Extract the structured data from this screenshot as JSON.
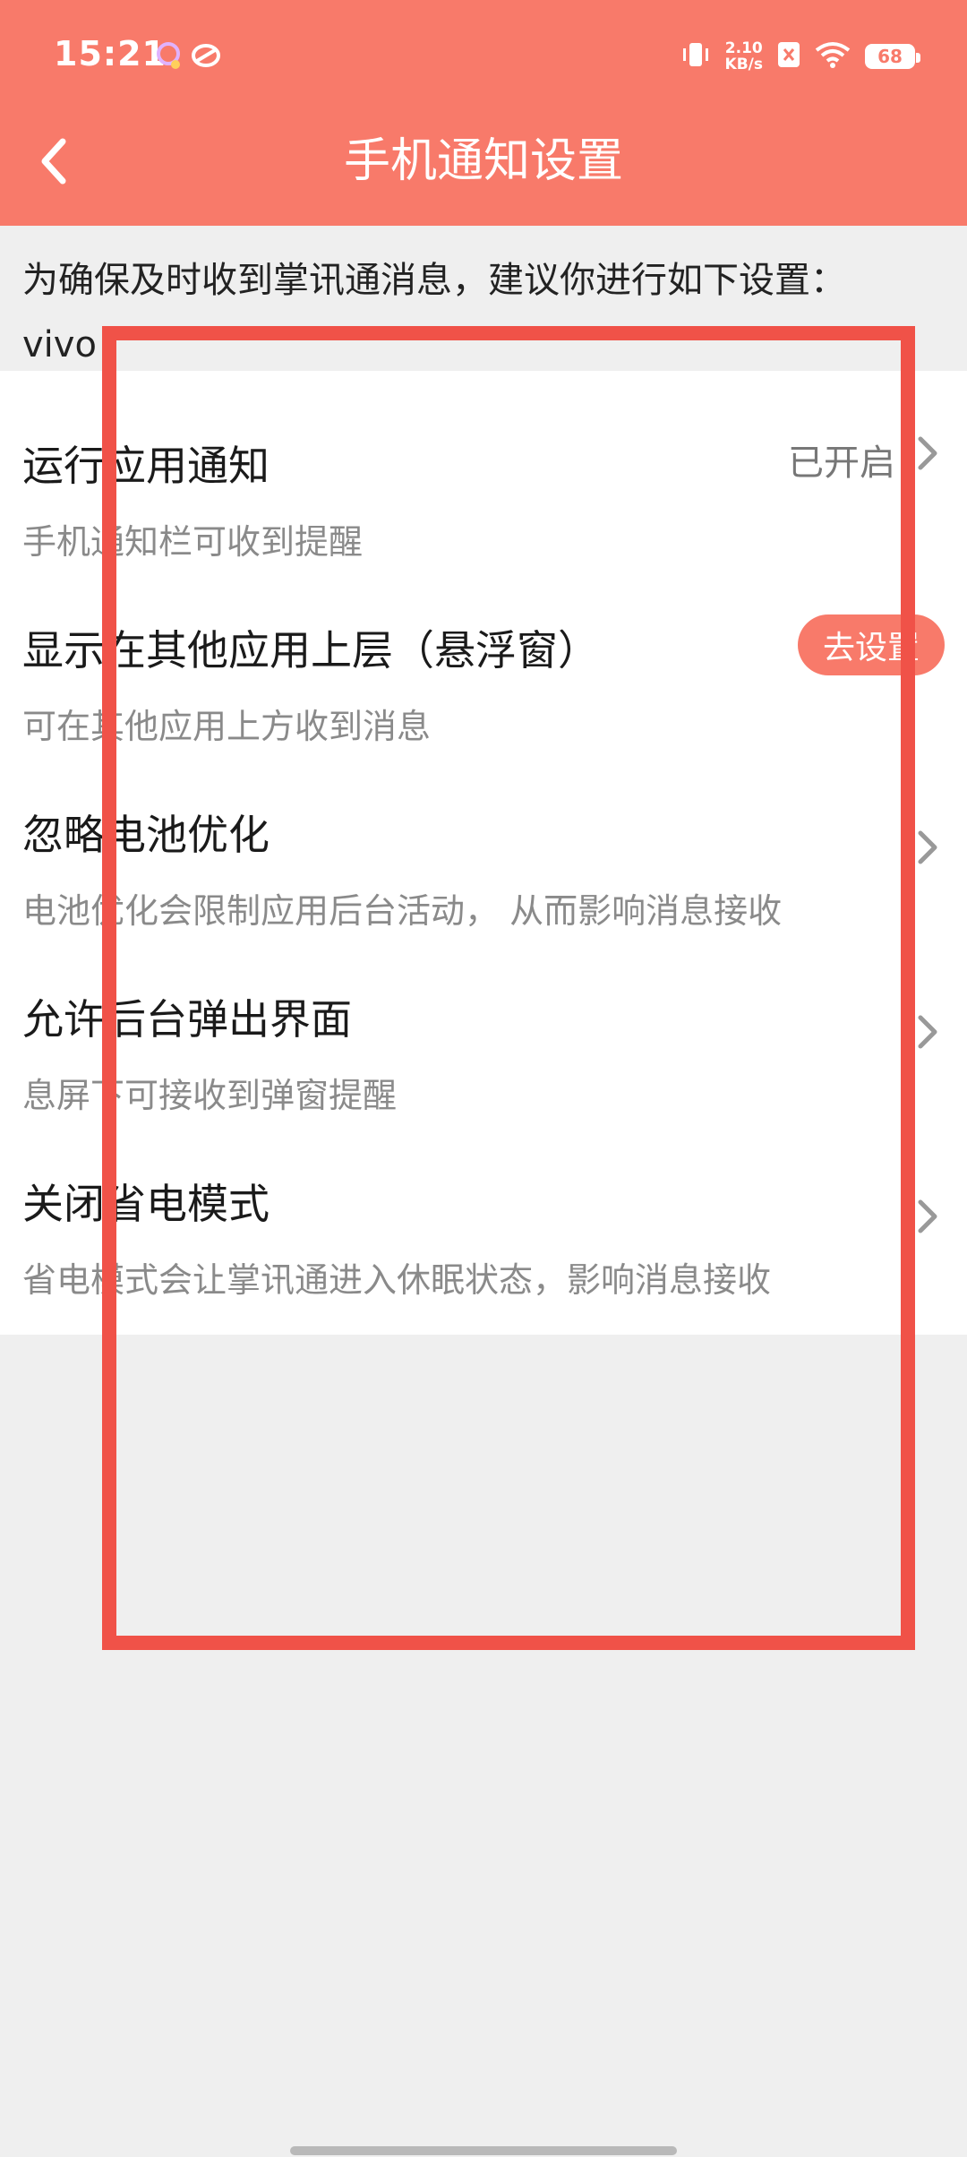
{
  "status_bar": {
    "time": "15:21",
    "net_speed_value": "2.10",
    "net_speed_unit": "KB/s",
    "battery_level": "68",
    "icons": [
      "notification-app-icon",
      "sync-icon",
      "vibrate-icon",
      "no-sim-icon",
      "wifi-icon",
      "battery-icon"
    ]
  },
  "nav": {
    "title": "手机通知设置",
    "back_icon": "chevron-left-icon"
  },
  "notice": {
    "text": "为确保及时收到掌讯通消息，建议你进行如下设置：",
    "brand": "vivo"
  },
  "settings": [
    {
      "title": "运行应用通知",
      "desc": "手机通知栏可收到提醒",
      "status": "已开启",
      "action": "chevron"
    },
    {
      "title": "显示在其他应用上层（悬浮窗）",
      "desc": "可在其他应用上方收到消息",
      "button": "去设置",
      "action": "button"
    },
    {
      "title": "忽略电池优化",
      "desc": "电池优化会限制应用后台活动， 从而影响消息接收",
      "action": "chevron"
    },
    {
      "title": "允许后台弹出界面",
      "desc": "息屏下可接收到弹窗提醒",
      "action": "chevron"
    },
    {
      "title": "关闭省电模式",
      "desc": "省电模式会让掌讯通进入休眠状态，影响消息接收",
      "action": "chevron"
    }
  ],
  "colors": {
    "accent": "#f87a6a",
    "highlight": "#f05248",
    "background": "#efefef"
  }
}
